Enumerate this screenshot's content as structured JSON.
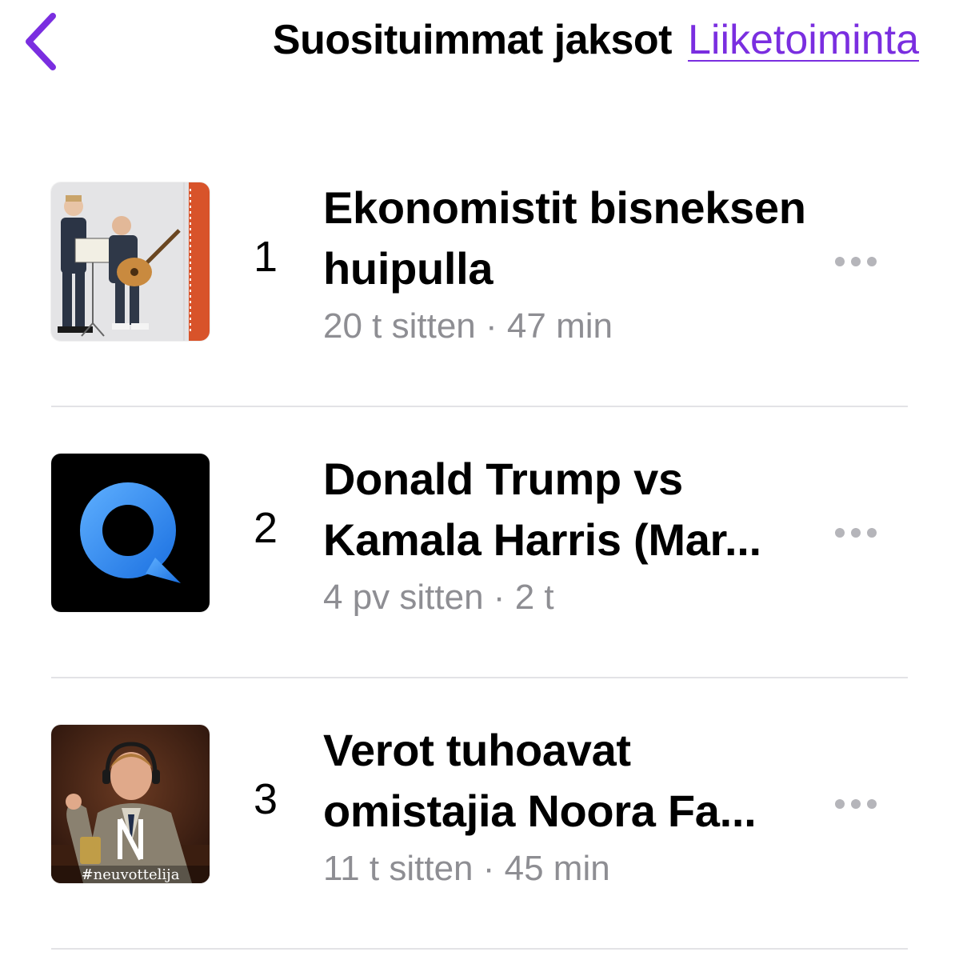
{
  "colors": {
    "accent": "#7a2ee0",
    "secondary_text": "#8e8e93",
    "divider": "#e3e3e6"
  },
  "nav": {
    "back_icon": "chevron-left-icon",
    "title": "Suosituimmat jaksot",
    "category_link": "Liiketoiminta"
  },
  "episodes": [
    {
      "rank": "1",
      "title": "Ekonomistit bisneksen huipulla",
      "age": "20 t sitten",
      "separator": "·",
      "duration": "47 min",
      "artwork": "two-men-with-music-stand-and-guitar-artwork",
      "more_icon": "more-ellipsis-icon"
    },
    {
      "rank": "2",
      "title": "Donald Trump vs Kamala Harris (Mar...",
      "age": "4 pv sitten",
      "separator": "·",
      "duration": "2 t",
      "artwork": "blue-q-speech-bubble-logo-artwork",
      "more_icon": "more-ellipsis-icon"
    },
    {
      "rank": "3",
      "title": "Verot tuhoavat omistajia Noora Fa...",
      "age": "11 t sitten",
      "separator": "·",
      "duration": "45 min",
      "artwork": "man-with-headphones-neuvottelija-artwork",
      "artwork_caption": "#neuvottelija",
      "more_icon": "more-ellipsis-icon"
    }
  ]
}
